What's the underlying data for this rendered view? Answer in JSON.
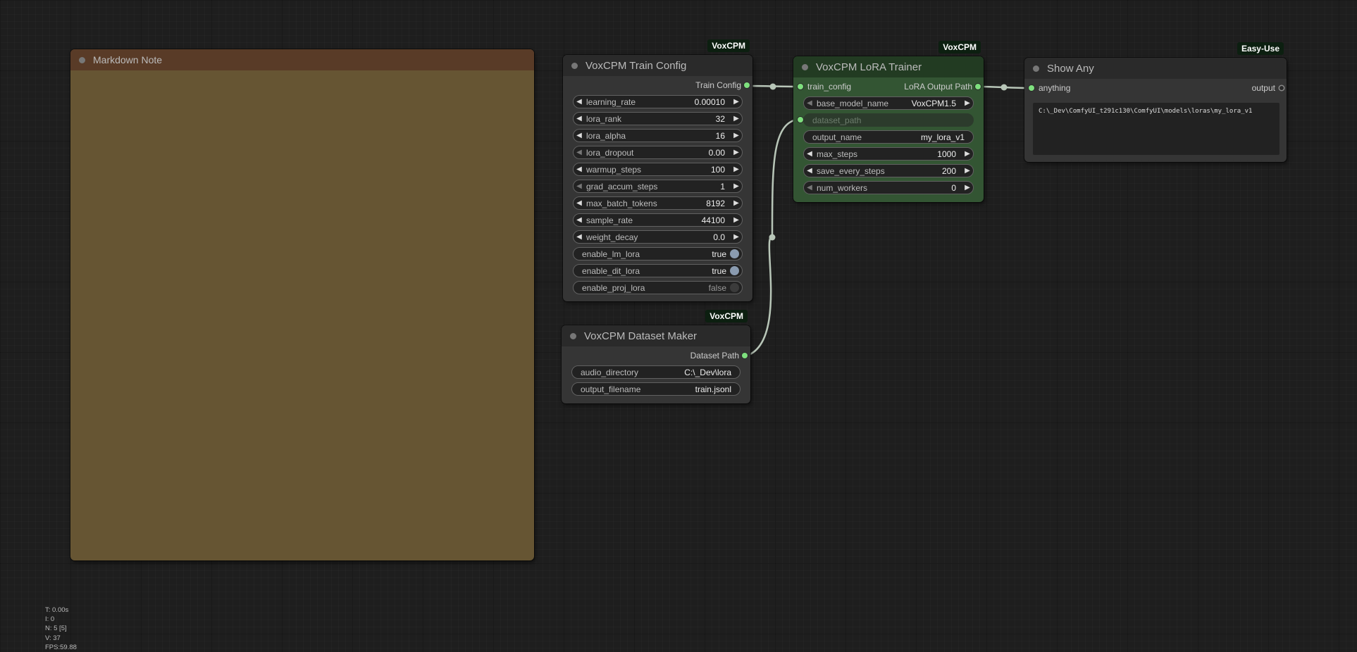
{
  "note": {
    "title": "Markdown Note"
  },
  "train_config": {
    "badge": "VoxCPM",
    "title": "VoxCPM Train Config",
    "output_label": "Train Config",
    "widgets": [
      {
        "label": "learning_rate",
        "value": "0.00010"
      },
      {
        "label": "lora_rank",
        "value": "32"
      },
      {
        "label": "lora_alpha",
        "value": "16"
      },
      {
        "label": "lora_dropout",
        "value": "0.00"
      },
      {
        "label": "warmup_steps",
        "value": "100"
      },
      {
        "label": "grad_accum_steps",
        "value": "1"
      },
      {
        "label": "max_batch_tokens",
        "value": "8192"
      },
      {
        "label": "sample_rate",
        "value": "44100"
      },
      {
        "label": "weight_decay",
        "value": "0.0"
      }
    ],
    "toggles": [
      {
        "label": "enable_lm_lora",
        "value": "true"
      },
      {
        "label": "enable_dit_lora",
        "value": "true"
      },
      {
        "label": "enable_proj_lora",
        "value": "false"
      }
    ]
  },
  "dataset_maker": {
    "badge": "VoxCPM",
    "title": "VoxCPM Dataset Maker",
    "output_label": "Dataset Path",
    "widgets": [
      {
        "label": "audio_directory",
        "value": "C:\\_Dev\\lora"
      },
      {
        "label": "output_filename",
        "value": "train.jsonl"
      }
    ]
  },
  "lora_trainer": {
    "badge": "VoxCPM",
    "title": "VoxCPM LoRA Trainer",
    "input_label": "train_config",
    "output_label": "LoRA Output Path",
    "base_model": {
      "label": "base_model_name",
      "value": "VoxCPM1.5"
    },
    "dataset_path_label": "dataset_path",
    "output_name": {
      "label": "output_name",
      "value": "my_lora_v1"
    },
    "max_steps": {
      "label": "max_steps",
      "value": "1000"
    },
    "save_every_steps": {
      "label": "save_every_steps",
      "value": "200"
    },
    "num_workers": {
      "label": "num_workers",
      "value": "0"
    }
  },
  "show_any": {
    "badge": "Easy-Use",
    "title": "Show Any",
    "input_label": "anything",
    "output_label": "output",
    "text": "C:\\_Dev\\ComfyUI_t291c130\\ComfyUI\\models\\loras\\my_lora_v1"
  },
  "stats": {
    "t": "T: 0.00s",
    "i": "I: 0",
    "n": "N: 5 [5]",
    "v": "V: 37",
    "fps": "FPS:59.88"
  },
  "colors": {
    "canvas_bg": "#1e1e1e",
    "node_bg": "#353535",
    "note_bg": "#665533",
    "trainer_bg": "#335533",
    "slot_active": "#7ee07e",
    "link": "#b8c6b8"
  }
}
